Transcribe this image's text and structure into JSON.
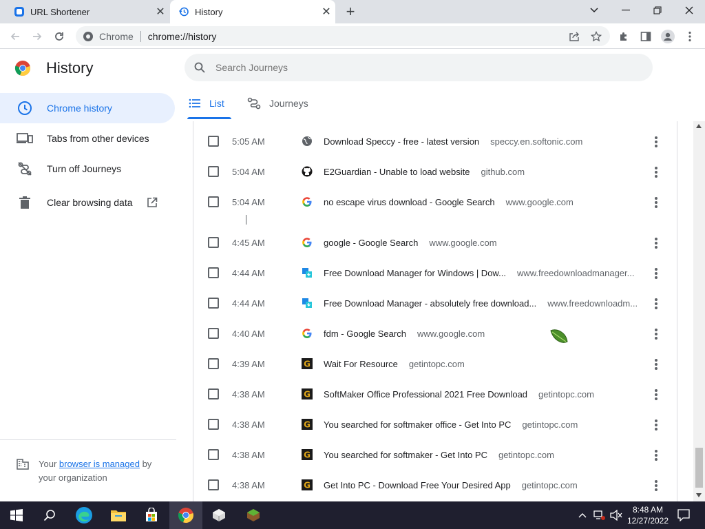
{
  "tabs": [
    {
      "title": "URL Shortener",
      "icon": "url-shortener-favicon",
      "close": "✕"
    },
    {
      "title": "History",
      "icon": "history-icon",
      "close": "✕"
    }
  ],
  "new_tab_glyph": "+",
  "window_controls": {
    "dropdown": "⌄",
    "minimize": "—",
    "maximize": "❐",
    "close": "✕"
  },
  "omnibox": {
    "site_label": "Chrome",
    "url": "chrome://history"
  },
  "page": {
    "title": "History"
  },
  "search": {
    "placeholder": "Search Journeys"
  },
  "sidebar": {
    "items": [
      {
        "label": "Chrome history",
        "icon": "clock-icon",
        "active": true
      },
      {
        "label": "Tabs from other devices",
        "icon": "devices-icon"
      },
      {
        "label": "Turn off Journeys",
        "icon": "journeys-off-icon"
      },
      {
        "label": "Clear browsing data",
        "icon": "trash-icon"
      }
    ],
    "managed": {
      "prefix": "Your ",
      "link": "browser is managed",
      "suffix": " by",
      "line2": "your organization"
    }
  },
  "view_tabs": [
    {
      "label": "List",
      "icon": "list-icon",
      "active": true
    },
    {
      "label": "Journeys",
      "icon": "journeys-icon"
    }
  ],
  "history": [
    {
      "time": "5:05 AM",
      "title": "Download Speccy - free - latest version",
      "domain": "speccy.en.softonic.com",
      "favicon": "globe"
    },
    {
      "time": "5:04 AM",
      "title": "E2Guardian - Unable to load website",
      "domain": "github.com",
      "favicon": "github"
    },
    {
      "time": "5:04 AM",
      "title": "no escape virus download - Google Search",
      "domain": "www.google.com",
      "favicon": "google"
    },
    {
      "time": "4:45 AM",
      "title": "google - Google Search",
      "domain": "www.google.com",
      "favicon": "google"
    },
    {
      "time": "4:44 AM",
      "title": "Free Download Manager for Windows | Dow...",
      "domain": "www.freedownloadmanager...",
      "favicon": "fdm"
    },
    {
      "time": "4:44 AM",
      "title": "Free Download Manager - absolutely free download...",
      "domain": "www.freedownloadm...",
      "favicon": "fdm"
    },
    {
      "time": "4:40 AM",
      "title": "fdm - Google Search",
      "domain": "www.google.com",
      "favicon": "google"
    },
    {
      "time": "4:39 AM",
      "title": "Wait For Resource",
      "domain": "getintopc.com",
      "favicon": "getintopc"
    },
    {
      "time": "4:38 AM",
      "title": "SoftMaker Office Professional 2021 Free Download",
      "domain": "getintopc.com",
      "favicon": "getintopc"
    },
    {
      "time": "4:38 AM",
      "title": "You searched for softmaker office - Get Into PC",
      "domain": "getintopc.com",
      "favicon": "getintopc"
    },
    {
      "time": "4:38 AM",
      "title": "You searched for softmaker - Get Into PC",
      "domain": "getintopc.com",
      "favicon": "getintopc"
    },
    {
      "time": "4:38 AM",
      "title": "Get Into PC - Download Free Your Desired App",
      "domain": "getintopc.com",
      "favicon": "getintopc"
    }
  ],
  "taskbar": {
    "time": "8:48 AM",
    "date": "12/27/2022"
  },
  "colors": {
    "accent": "#1a73e8",
    "sidebar_active_bg": "#e8f0fe",
    "taskbar": "#1f1f2f"
  }
}
